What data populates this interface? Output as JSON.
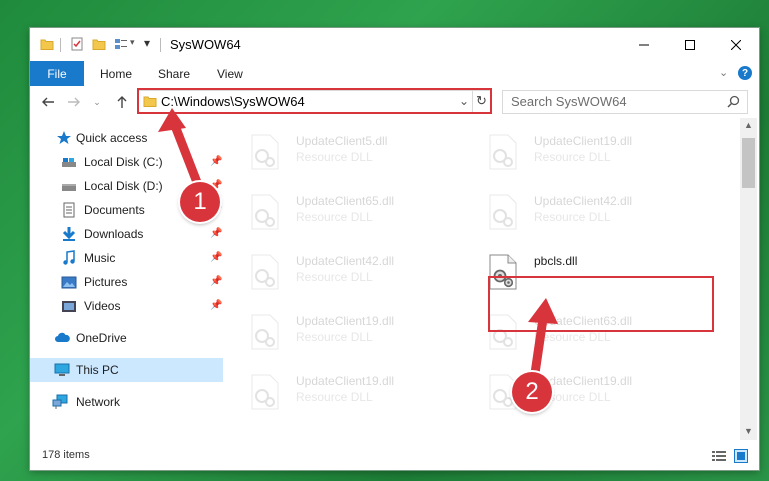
{
  "window": {
    "title": "SysWOW64",
    "controls": {
      "minimize": "minimize",
      "maximize": "maximize",
      "close": "close"
    }
  },
  "ribbon": {
    "file_label": "File",
    "tabs": [
      "Home",
      "Share",
      "View"
    ]
  },
  "navigation": {
    "address": "C:\\Windows\\SysWOW64",
    "search_placeholder": "Search SysWOW64"
  },
  "sidebar": {
    "items": [
      {
        "label": "Quick access",
        "icon": "star-icon"
      },
      {
        "label": "Local Disk (C:)",
        "icon": "drive-icon",
        "pinned": true
      },
      {
        "label": "Local Disk (D:)",
        "icon": "drive-icon",
        "pinned": true
      },
      {
        "label": "Documents",
        "icon": "documents-icon",
        "pinned": true
      },
      {
        "label": "Downloads",
        "icon": "download-icon",
        "pinned": true
      },
      {
        "label": "Music",
        "icon": "music-icon",
        "pinned": true
      },
      {
        "label": "Pictures",
        "icon": "pictures-icon",
        "pinned": true
      },
      {
        "label": "Videos",
        "icon": "videos-icon",
        "pinned": true
      },
      {
        "label": "OneDrive",
        "icon": "cloud-icon"
      },
      {
        "label": "This PC",
        "icon": "computer-icon",
        "selected": true
      },
      {
        "label": "Network",
        "icon": "network-icon"
      }
    ]
  },
  "files": [
    {
      "name": "UpdateClient5.dll",
      "type": "Resource DLL",
      "faded": true
    },
    {
      "name": "UpdateClient19.dll",
      "type": "Resource DLL",
      "faded": true
    },
    {
      "name": "UpdateClient65.dll",
      "type": "Resource DLL",
      "faded": true
    },
    {
      "name": "UpdateClient42.dll",
      "type": "Resource DLL",
      "faded": true
    },
    {
      "name": "UpdateClient42.dll",
      "type": "Resource DLL",
      "faded": true
    },
    {
      "name": "pbcls.dll",
      "type": "",
      "faded": false
    },
    {
      "name": "UpdateClient19.dll",
      "type": "Resource DLL",
      "faded": true
    },
    {
      "name": "UpdateClient63.dll",
      "type": "Resource DLL",
      "faded": true
    },
    {
      "name": "UpdateClient19.dll",
      "type": "Resource DLL",
      "faded": true
    },
    {
      "name": "UpdateClient19.dll",
      "type": "Resource DLL",
      "faded": true
    }
  ],
  "status": {
    "item_count": "178 items"
  },
  "annotations": {
    "step1": "1",
    "step2": "2",
    "color": "#d8343c"
  },
  "colors": {
    "accent": "#1979ca",
    "selection": "#cce8ff",
    "highlight": "#d8343c"
  }
}
